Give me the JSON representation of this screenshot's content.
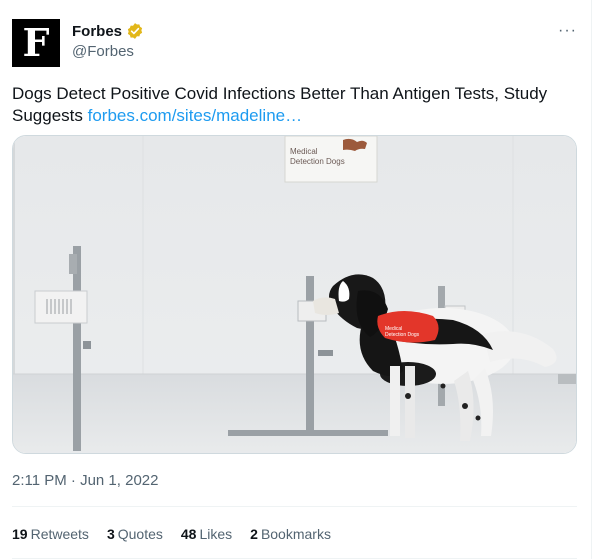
{
  "author": {
    "avatar_letter": "F",
    "display_name": "Forbes",
    "handle": "@Forbes",
    "verified_badge": "verified-gold-icon",
    "verified_color": "#e2b719"
  },
  "more_icon": "···",
  "tweet": {
    "text": "Dogs Detect Positive Covid Infections Better Than Antigen Tests, Study Suggests",
    "link": "forbes.com/sites/madeline…",
    "link_color": "#1d9bf0"
  },
  "media": {
    "sign_line1": "Medical",
    "sign_line2": "Detection Dogs",
    "vest_text1": "Medical",
    "vest_text2": "Detection Dogs"
  },
  "timestamp": "2:11 PM · Jun 1, 2022",
  "stats": {
    "retweets_count": "19",
    "retweets_label": "Retweets",
    "quotes_count": "3",
    "quotes_label": "Quotes",
    "likes_count": "48",
    "likes_label": "Likes",
    "bookmarks_count": "2",
    "bookmarks_label": "Bookmarks"
  }
}
